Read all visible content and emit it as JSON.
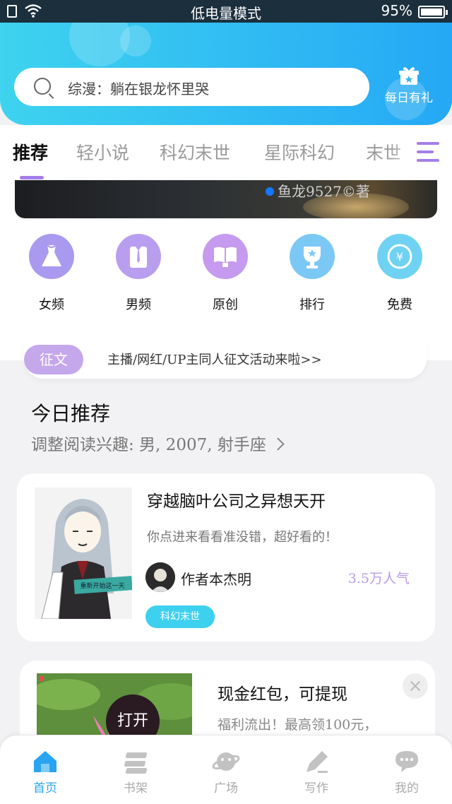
{
  "status_bar": {
    "mode": "低电量模式",
    "battery": "95%"
  },
  "header": {
    "search_placeholder": "综漫：躺在银龙怀里哭",
    "gift_label": "每日有礼"
  },
  "tabs": [
    "推荐",
    "轻小说",
    "科幻末世",
    "星际科幻",
    "末世"
  ],
  "banner": {
    "signature": "鱼龙9527©著"
  },
  "categories": [
    {
      "label": "女频",
      "icon": "dress-icon",
      "color": "#a99af0"
    },
    {
      "label": "男频",
      "icon": "shirt-icon",
      "color": "#b99ef0"
    },
    {
      "label": "原创",
      "icon": "book-icon",
      "color": "#c69aee"
    },
    {
      "label": "排行",
      "icon": "trophy-icon",
      "color": "#7cc8f5"
    },
    {
      "label": "免费",
      "icon": "coin-icon",
      "color": "#6fd2f2"
    }
  ],
  "notice": {
    "tag": "征文",
    "text": "主播/网红/UP主同人征文活动来啦>>"
  },
  "today": {
    "title": "今日推荐",
    "subtitle": "调整阅读兴趣: 男, 2007, 射手座"
  },
  "book": {
    "title": "穿越脑叶公司之异想天开",
    "description": "你点进来看看准没错，超好看的！",
    "author": "作者本杰明",
    "popularity": "3.5万人气",
    "tag": "科幻末世",
    "cover_caption": "重新开始这一天"
  },
  "ad": {
    "title": "现金红包，可提现",
    "description": "福利流出！最高领100元，",
    "open_label": "打开"
  },
  "bottom_nav": [
    {
      "label": "首页",
      "icon": "home-icon",
      "active": true
    },
    {
      "label": "书架",
      "icon": "bookshelf-icon",
      "active": false
    },
    {
      "label": "广场",
      "icon": "planet-icon",
      "active": false
    },
    {
      "label": "写作",
      "icon": "pen-icon",
      "active": false
    },
    {
      "label": "我的",
      "icon": "chat-icon",
      "active": false
    }
  ],
  "colors": {
    "accent_blue": "#29a4f0",
    "accent_purple": "#a47ee8",
    "tag_cyan": "#3ed0ef"
  }
}
